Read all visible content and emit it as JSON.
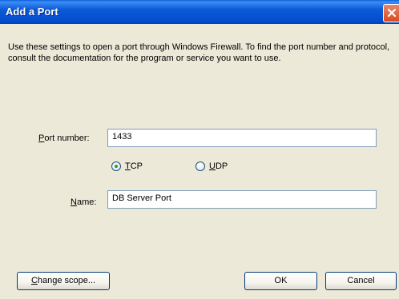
{
  "window": {
    "title": "Add a Port",
    "description": "Use these settings to open a port through Windows Firewall. To find the port number and protocol, consult the documentation for the program or service you want to use."
  },
  "form": {
    "port_label_underlined": "P",
    "port_label_rest": "ort number:",
    "port_value": "1433",
    "tcp_label_underlined": "T",
    "tcp_label_rest": "CP",
    "udp_label_underlined": "U",
    "udp_label_rest": "DP",
    "protocol_selected": "TCP",
    "name_label_underlined": "N",
    "name_label_rest": "ame:",
    "name_value": "DB Server Port"
  },
  "buttons": {
    "change_scope_underlined": "C",
    "change_scope_rest": "hange scope...",
    "ok": "OK",
    "cancel": "Cancel"
  },
  "icons": {
    "close": "close-icon"
  }
}
